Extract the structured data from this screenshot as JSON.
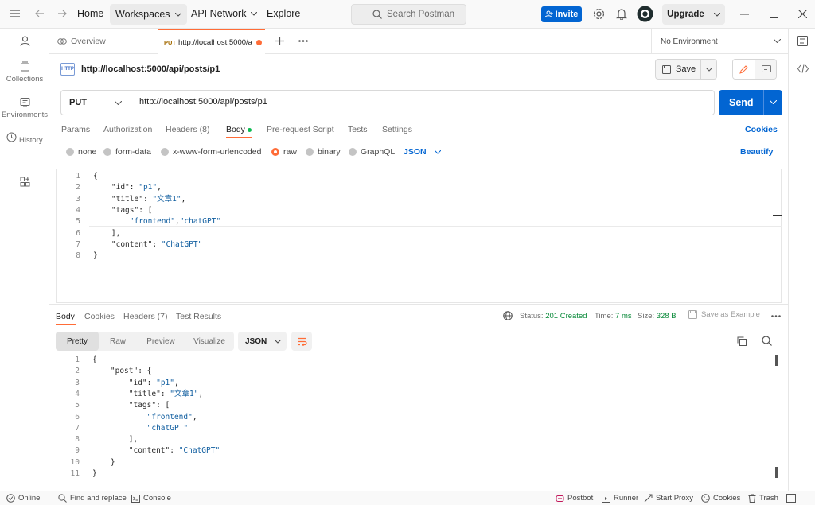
{
  "titlebar": {
    "home": "Home",
    "workspaces": "Workspaces",
    "api_network": "API Network",
    "explore": "Explore",
    "search_placeholder": "Search Postman",
    "invite": "Invite",
    "upgrade": "Upgrade"
  },
  "leftrail": {
    "collections": "Collections",
    "environments": "Environments",
    "history": "History"
  },
  "tabs": {
    "overview": "Overview",
    "active_method": "PUT",
    "active_label": "http://localhost:5000/a",
    "environment": "No Environment"
  },
  "request": {
    "title": "http://localhost:5000/api/posts/p1",
    "save": "Save",
    "method": "PUT",
    "url": "http://localhost:5000/api/posts/p1",
    "send": "Send",
    "tabs": [
      "Params",
      "Authorization",
      "Headers (8)",
      "Body",
      "Pre-request Script",
      "Tests",
      "Settings"
    ],
    "cookies": "Cookies",
    "body_modes": [
      "none",
      "form-data",
      "x-www-form-urlencoded",
      "raw",
      "binary",
      "GraphQL"
    ],
    "body_format": "JSON",
    "beautify": "Beautify",
    "body_lines": [
      "{",
      "    \"id\": \"p1\",",
      "    \"title\": \"文章1\",",
      "    \"tags\": [",
      "        \"frontend\",\"chatGPT\"",
      "    ],",
      "    \"content\": \"ChatGPT\"",
      "}"
    ]
  },
  "response": {
    "tabs": [
      "Body",
      "Cookies",
      "Headers (7)",
      "Test Results"
    ],
    "status_label": "Status:",
    "status_value": "201 Created",
    "time_label": "Time:",
    "time_value": "7 ms",
    "size_label": "Size:",
    "size_value": "328 B",
    "save_example": "Save as Example",
    "views": [
      "Pretty",
      "Raw",
      "Preview",
      "Visualize"
    ],
    "format": "JSON",
    "lines": [
      "{",
      "    \"post\": {",
      "        \"id\": \"p1\",",
      "        \"title\": \"文章1\",",
      "        \"tags\": [",
      "            \"frontend\",",
      "            \"chatGPT\"",
      "        ],",
      "        \"content\": \"ChatGPT\"",
      "    }",
      "}"
    ]
  },
  "statusbar": {
    "online": "Online",
    "find_replace": "Find and replace",
    "console": "Console",
    "postbot": "Postbot",
    "runner": "Runner",
    "start_proxy": "Start Proxy",
    "cookies": "Cookies",
    "trash": "Trash"
  },
  "colors": {
    "accent": "#ff6c37",
    "primary": "#0265d2",
    "status_ok": "#0a8a3a"
  }
}
